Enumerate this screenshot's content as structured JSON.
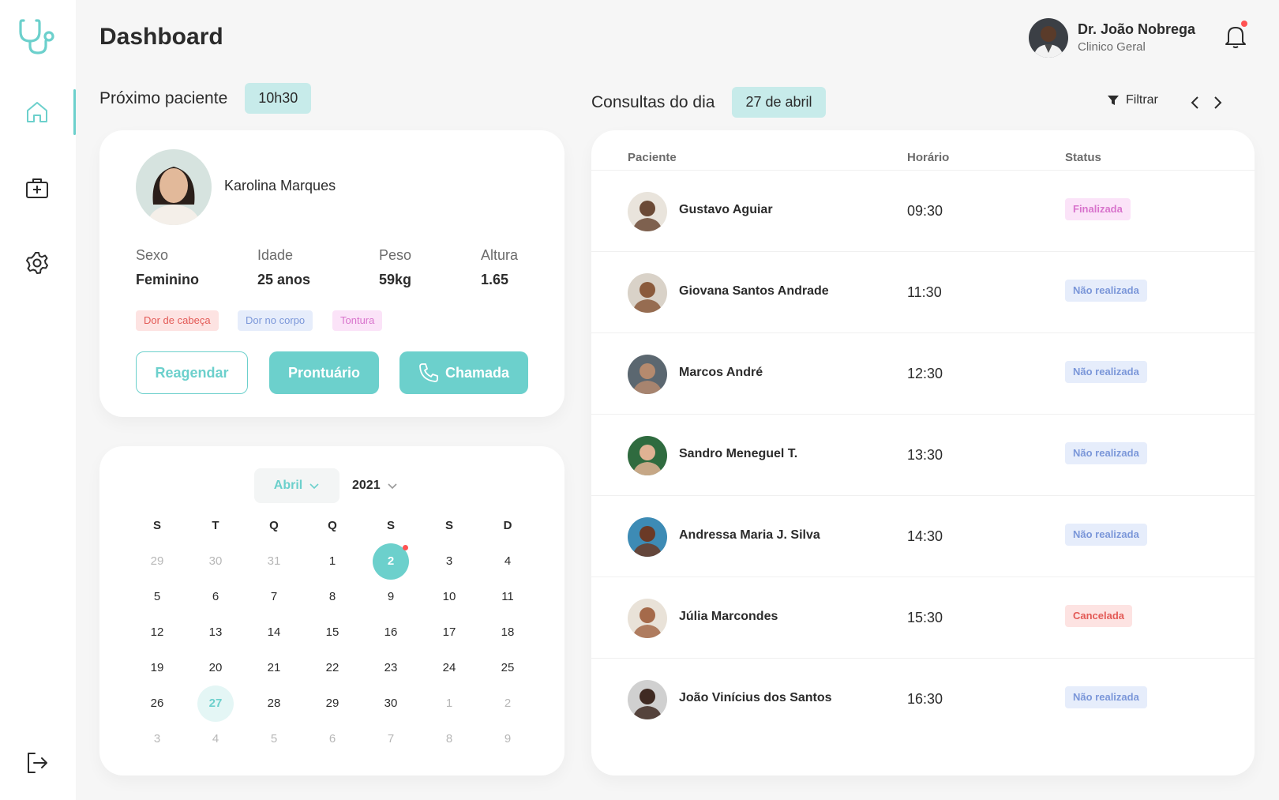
{
  "app": {
    "title": "Dashboard",
    "accent_color": "#6cd0cc"
  },
  "sidebar": {
    "items": [
      {
        "icon": "home-icon",
        "active": true
      },
      {
        "icon": "medical-kit-icon",
        "active": false
      },
      {
        "icon": "gear-icon",
        "active": false
      },
      {
        "icon": "logout-icon",
        "active": false
      }
    ]
  },
  "user": {
    "name": "Dr. João Nobrega",
    "role": "Clinico Geral",
    "has_notification": true
  },
  "next_patient": {
    "heading": "Próximo paciente",
    "time": "10h30",
    "name": "Karolina Marques",
    "stats": [
      {
        "label": "Sexo",
        "value": "Feminino"
      },
      {
        "label": "Idade",
        "value": "25 anos"
      },
      {
        "label": "Peso",
        "value": "59kg"
      },
      {
        "label": "Altura",
        "value": "1.65"
      }
    ],
    "tags": [
      "Dor de cabeça",
      "Dor no corpo",
      "Tontura"
    ],
    "buttons": {
      "reschedule": "Reagendar",
      "record": "Prontuário",
      "call": "Chamada"
    }
  },
  "calendar": {
    "month": "Abril",
    "year": "2021",
    "weekdays": [
      "S",
      "T",
      "Q",
      "Q",
      "S",
      "S",
      "D"
    ],
    "weeks": [
      [
        "29",
        "30",
        "31",
        "1",
        "2",
        "3",
        "4"
      ],
      [
        "5",
        "6",
        "7",
        "8",
        "9",
        "10",
        "11"
      ],
      [
        "12",
        "13",
        "14",
        "15",
        "16",
        "17",
        "18"
      ],
      [
        "19",
        "20",
        "21",
        "22",
        "23",
        "24",
        "25"
      ],
      [
        "26",
        "27",
        "28",
        "29",
        "30",
        "1",
        "2"
      ],
      [
        "3",
        "4",
        "5",
        "6",
        "7",
        "8",
        "9"
      ]
    ],
    "selected_day": "2",
    "today": "27"
  },
  "appointments": {
    "heading": "Consultas do dia",
    "date": "27 de abril",
    "filter_label": "Filtrar",
    "columns": {
      "patient": "Paciente",
      "time": "Horário",
      "status": "Status"
    },
    "rows": [
      {
        "name": "Gustavo Aguiar",
        "time": "09:30",
        "status": "Finalizada",
        "kind": "done"
      },
      {
        "name": "Giovana Santos Andrade",
        "time": "11:30",
        "status": "Não realizada",
        "kind": "pend"
      },
      {
        "name": "Marcos André",
        "time": "12:30",
        "status": "Não realizada",
        "kind": "pend"
      },
      {
        "name": "Sandro Meneguel T.",
        "time": "13:30",
        "status": "Não realizada",
        "kind": "pend"
      },
      {
        "name": "Andressa Maria J. Silva",
        "time": "14:30",
        "status": "Não realizada",
        "kind": "pend"
      },
      {
        "name": "Júlia Marcondes",
        "time": "15:30",
        "status": "Cancelada",
        "kind": "canc"
      },
      {
        "name": "João Vinícius dos Santos",
        "time": "16:30",
        "status": "Não realizada",
        "kind": "pend"
      }
    ]
  }
}
